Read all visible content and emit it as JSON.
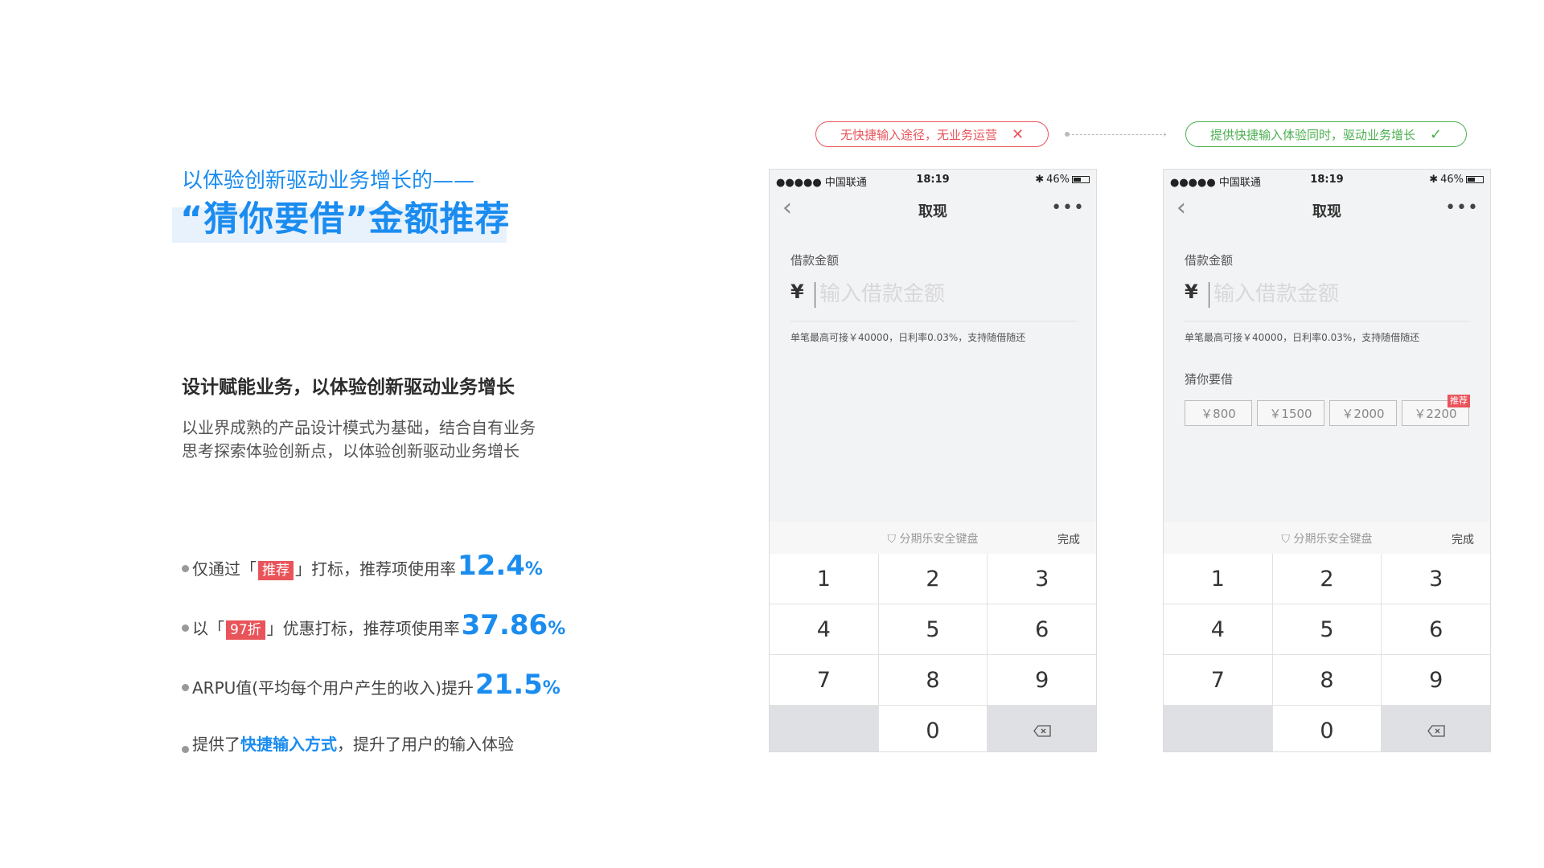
{
  "header": {
    "subtitle": "以体验创新驱动业务增长的——",
    "title": "“猜你要借”金额推荐"
  },
  "section": {
    "title": "设计赋能业务，以体验创新驱动业务增长",
    "desc_lines": [
      "以业界成熟的产品设计模式为基础，结合自有业务",
      "思考探索体验创新点，以体验创新驱动业务增长"
    ]
  },
  "bullets": [
    {
      "prefix": "仅通过「",
      "tag": "推荐",
      "suffix": "」打标，推荐项使用率",
      "value": "12.4",
      "unit": "%"
    },
    {
      "prefix": "以「",
      "tag": "97折",
      "suffix": "」优惠打标，推荐项使用率",
      "value": "37.86",
      "unit": "%"
    },
    {
      "prefix": "ARPU值(平均每个用户产生的收入)提升",
      "value": "21.5",
      "unit": "%"
    },
    {
      "prefix": "提供了",
      "highlight": "快捷输入方式",
      "suffix": "，提升了用户的输入体验"
    }
  ],
  "compare": {
    "bad_label": "无快捷输入途径，无业务运营",
    "bad_mark": "✕",
    "good_label": "提供快捷输入体验同时，驱动业务增长",
    "good_mark": "✓"
  },
  "phone": {
    "carrier": "●●●●● 中国联通",
    "time": "18:19",
    "battery": "46%",
    "nav_title": "取现",
    "back": "‹",
    "more": "•••",
    "amount_label": "借款金额",
    "currency": "¥",
    "amount_placeholder": "输入借款金额",
    "hint": "单笔最高可接￥40000，日利率0.03%，支持随借随还",
    "guess_label": "猜你要借",
    "chips": [
      "￥800",
      "￥1500",
      "￥2000",
      "￥2200"
    ],
    "chip_badge": "推荐",
    "keyboard_secure": "分期乐安全键盘",
    "keyboard_done": "完成",
    "keys": [
      "1",
      "2",
      "3",
      "4",
      "5",
      "6",
      "7",
      "8",
      "9",
      "",
      "0",
      ""
    ]
  },
  "colors": {
    "accent": "#1a8cf0",
    "tag_red": "#e9545a",
    "good_green": "#4caf50"
  }
}
